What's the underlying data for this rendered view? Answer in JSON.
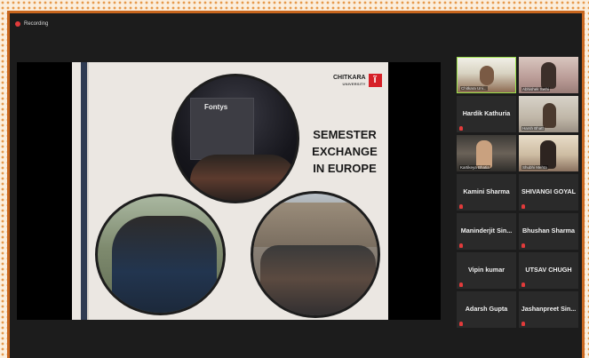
{
  "recording": {
    "label": "Recording"
  },
  "slide": {
    "title": "SEMESTER EXCHANGE IN EUROPE",
    "logo_name": "CHITKARA",
    "logo_sub": "UNIVERSITY",
    "logo_mark": "ĩ",
    "photo_sign": "Fontys"
  },
  "participants": [
    {
      "name": "Chitkara Uni...",
      "video": true,
      "active": true
    },
    {
      "name": "Abhishek Sethi",
      "video": true
    },
    {
      "name": "Hardik Kathuria",
      "video": false
    },
    {
      "name": "Harsh Bhatt",
      "video": true
    },
    {
      "name": "Kartikeya Bhatia",
      "video": true
    },
    {
      "name": "Shubhi Mehta",
      "video": true
    },
    {
      "name": "Kamini Sharma",
      "video": false
    },
    {
      "name": "SHIVANGI GOYAL",
      "video": false
    },
    {
      "name": "Maninderjit Sin...",
      "video": false
    },
    {
      "name": "Bhushan Sharma",
      "video": false
    },
    {
      "name": "Vipin kumar",
      "video": false
    },
    {
      "name": "UTSAV CHUGH",
      "video": false
    },
    {
      "name": "Adarsh Gupta",
      "video": false
    },
    {
      "name": "Jashanpreet Sin...",
      "video": false
    }
  ]
}
